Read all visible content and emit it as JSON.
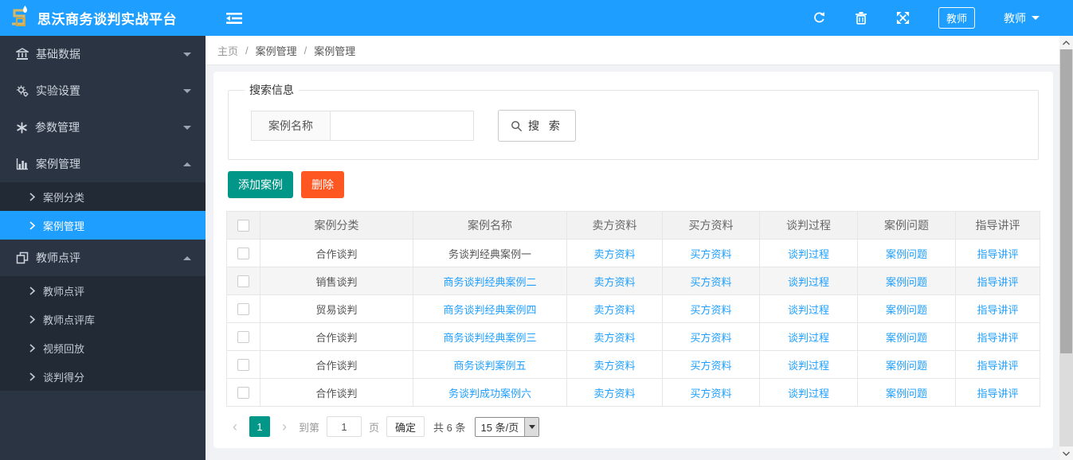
{
  "app": {
    "title": "思沃商务谈判实战平台"
  },
  "topbar": {
    "role_badge": "教师",
    "user_name": "教师"
  },
  "sidebar": {
    "items": [
      {
        "label": "基础数据"
      },
      {
        "label": "实验设置"
      },
      {
        "label": "参数管理"
      },
      {
        "label": "案例管理"
      },
      {
        "label": "教师点评"
      }
    ],
    "case_children": [
      {
        "label": "案例分类"
      },
      {
        "label": "案例管理"
      }
    ],
    "review_children": [
      {
        "label": "教师点评"
      },
      {
        "label": "教师点评库"
      },
      {
        "label": "视频回放"
      },
      {
        "label": "谈判得分"
      }
    ]
  },
  "breadcrumb": {
    "home": "主页",
    "sep": "/",
    "level1": "案例管理",
    "level2": "案例管理"
  },
  "search": {
    "legend": "搜索信息",
    "field_label": "案例名称",
    "input_value": "",
    "button_label": "搜 索"
  },
  "toolbar": {
    "add_label": "添加案例",
    "delete_label": "删除"
  },
  "table": {
    "headers": {
      "category": "案例分类",
      "name": "案例名称",
      "seller": "卖方资料",
      "buyer": "买方资料",
      "process": "谈判过程",
      "question": "案例问题",
      "guide": "指导讲评"
    },
    "rows": [
      {
        "category": "合作谈判",
        "name": "务谈判经典案例一",
        "seller": "卖方资料",
        "buyer": "买方资料",
        "process": "谈判过程",
        "question": "案例问题",
        "guide": "指导讲评"
      },
      {
        "category": "销售谈判",
        "name": "商务谈判经典案例二",
        "seller": "卖方资料",
        "buyer": "买方资料",
        "process": "谈判过程",
        "question": "案例问题",
        "guide": "指导讲评"
      },
      {
        "category": "贸易谈判",
        "name": "商务谈判经典案例四",
        "seller": "卖方资料",
        "buyer": "买方资料",
        "process": "谈判过程",
        "question": "案例问题",
        "guide": "指导讲评"
      },
      {
        "category": "合作谈判",
        "name": "商务谈判经典案例三",
        "seller": "卖方资料",
        "buyer": "买方资料",
        "process": "谈判过程",
        "question": "案例问题",
        "guide": "指导讲评"
      },
      {
        "category": "合作谈判",
        "name": "商务谈判案例五",
        "seller": "卖方资料",
        "buyer": "买方资料",
        "process": "谈判过程",
        "question": "案例问题",
        "guide": "指导讲评"
      },
      {
        "category": "合作谈判",
        "name": "务谈判成功案例六",
        "seller": "卖方资料",
        "buyer": "买方资料",
        "process": "谈判过程",
        "question": "案例问题",
        "guide": "指导讲评"
      }
    ]
  },
  "pagination": {
    "prev": "‹",
    "current_page": "1",
    "next": "›",
    "goto_prefix": "到第",
    "goto_value": "1",
    "goto_suffix": "页",
    "confirm_label": "确定",
    "total_label": "共 6 条",
    "page_size_label": "15 条/页"
  },
  "colors": {
    "topbar_blue": "#1e9fff",
    "sidebar_dark": "#2b3443",
    "add_teal": "#009688",
    "delete_orange": "#ff5722",
    "link_blue": "#1e9fff"
  }
}
